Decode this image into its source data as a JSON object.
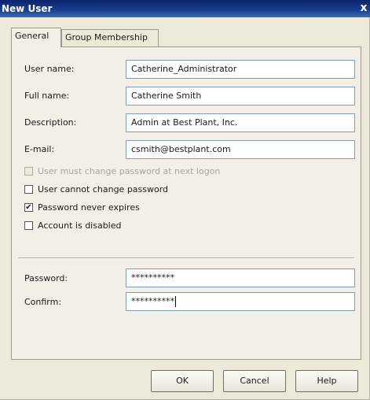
{
  "window": {
    "title": "New User",
    "close_glyph": "x"
  },
  "tabs": [
    {
      "label": "General",
      "active": true
    },
    {
      "label": "Group Membership",
      "active": false
    }
  ],
  "fields": [
    {
      "label": "User name:",
      "value": "Catherine_Administrator"
    },
    {
      "label": "Full name:",
      "value": "Catherine Smith"
    },
    {
      "label": "Description:",
      "value": "Admin at Best Plant, Inc."
    },
    {
      "label": "E-mail:",
      "value": "csmith@bestplant.com"
    }
  ],
  "checkboxes": [
    {
      "label": "User must change password at next logon",
      "checked": false,
      "disabled": true
    },
    {
      "label": "User cannot change password",
      "checked": false,
      "disabled": false
    },
    {
      "label": "Password never expires",
      "checked": true,
      "disabled": false
    },
    {
      "label": "Account is disabled",
      "checked": false,
      "disabled": false
    }
  ],
  "password": {
    "label": "Password:",
    "value": "**********",
    "confirm_label": "Confirm:",
    "confirm_value": "**********"
  },
  "buttons": {
    "ok": "OK",
    "cancel": "Cancel",
    "help": "Help"
  },
  "check_glyph": "✔",
  "colors": {
    "titlebar": "#0a246a",
    "dialog_bg": "#ece9d8",
    "input_border": "#7f9db9"
  }
}
